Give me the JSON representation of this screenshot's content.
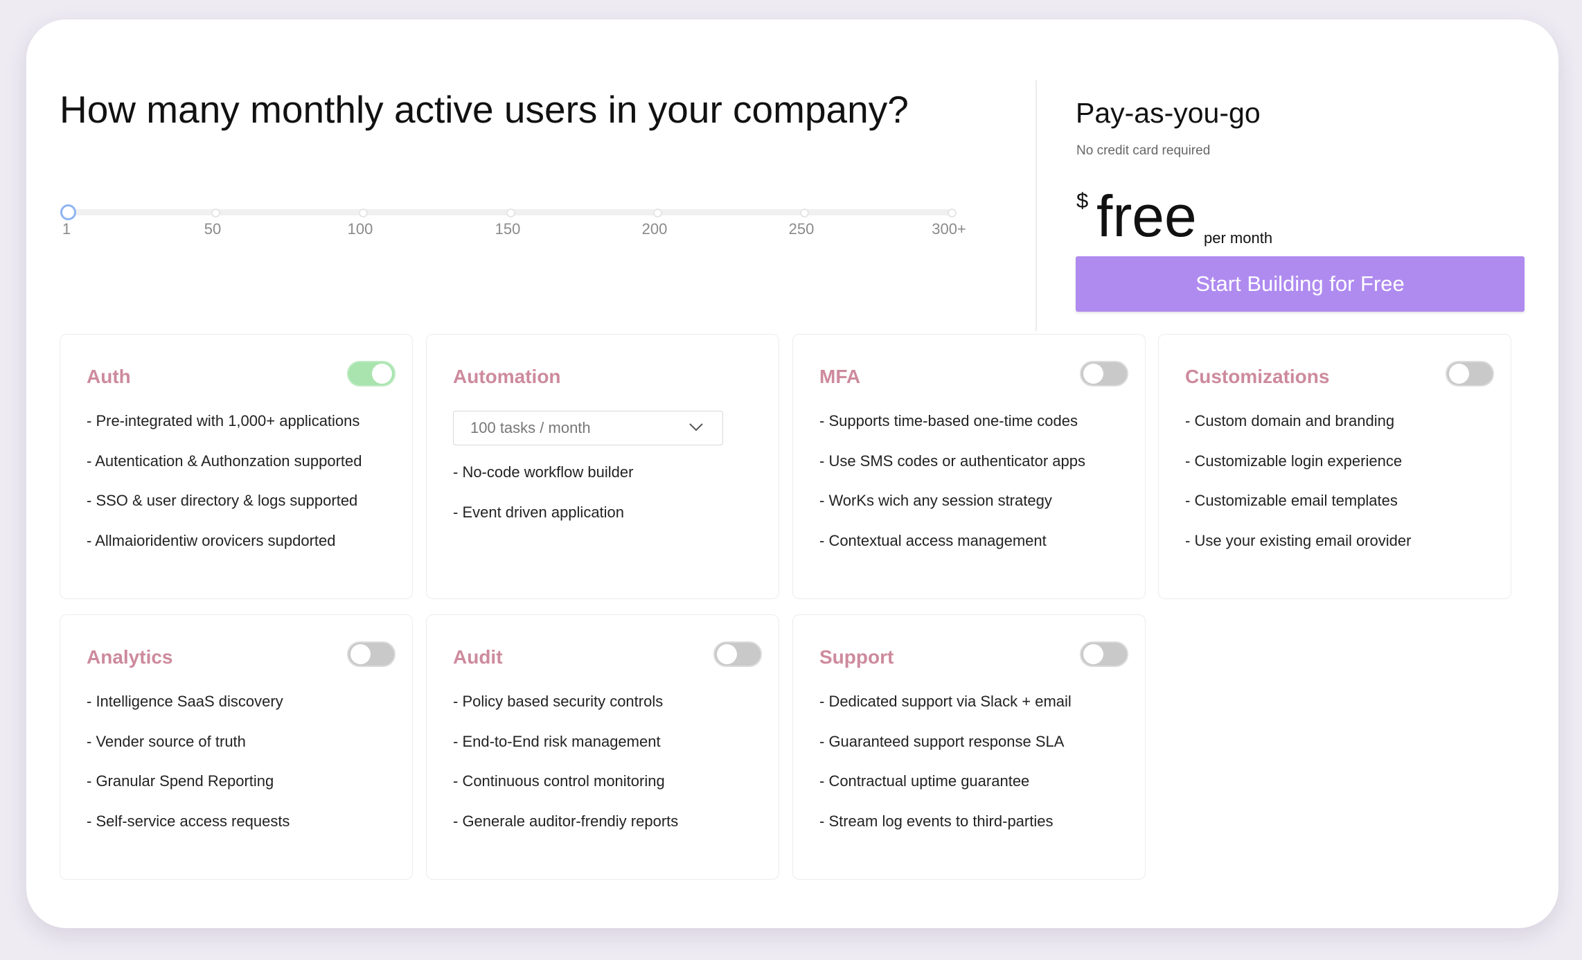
{
  "question": "How many monthly active users in your company?",
  "slider": {
    "value": 1,
    "ticks": [
      "1",
      "50",
      "100",
      "150",
      "200",
      "250",
      "300+"
    ],
    "handle_color": "#8fb4f0"
  },
  "plan": {
    "title": "Pay-as-you-go",
    "subtitle": "No credit card required",
    "currency": "$",
    "price": "free",
    "period": "per month",
    "cta": "Start Building for Free",
    "cta_color": "#af8bf0"
  },
  "features": [
    {
      "title": "Auth",
      "enabled": true,
      "items": [
        "- Pre-integrated with 1,000+ applications",
        "- Autentication & Authonzation supported",
        "- SSO & user directory & logs supported",
        "- Allmaioridentiw orovicers supdorted"
      ]
    },
    {
      "title": "Automation",
      "select": "100 tasks / month",
      "items": [
        "- No-code workflow builder",
        "- Event driven application"
      ]
    },
    {
      "title": "MFA",
      "enabled": false,
      "items": [
        "- Supports time-based one-time codes",
        "- Use SMS codes or authenticator apps",
        "- WorKs wich any session strategy",
        "- Contextual access management"
      ]
    },
    {
      "title": "Customizations",
      "enabled": false,
      "items": [
        "- Custom domain and branding",
        "- Customizable login experience",
        "- Customizable email templates",
        "- Use your existing email orovider"
      ]
    },
    {
      "title": "Analytics",
      "enabled": false,
      "items": [
        "- Intelligence SaaS discovery",
        "- Vender source of truth",
        "- Granular Spend Reporting",
        "- Self-service access requests"
      ]
    },
    {
      "title": "Audit",
      "enabled": false,
      "items": [
        "- Policy based security controls",
        "- End-to-End risk management",
        "- Continuous control monitoring",
        "- Generale auditor-frendiy reports"
      ]
    },
    {
      "title": "Support",
      "enabled": false,
      "items": [
        "- Dedicated support via Slack + email",
        "- Guaranteed support response SLA",
        "- Contractual uptime guarantee",
        "- Stream log events to third-parties"
      ]
    }
  ],
  "colors": {
    "feature_title": "#cd8a9d",
    "toggle_on": "#a9e4af",
    "toggle_off": "#c9c9c9",
    "background": "#eeebf3"
  }
}
